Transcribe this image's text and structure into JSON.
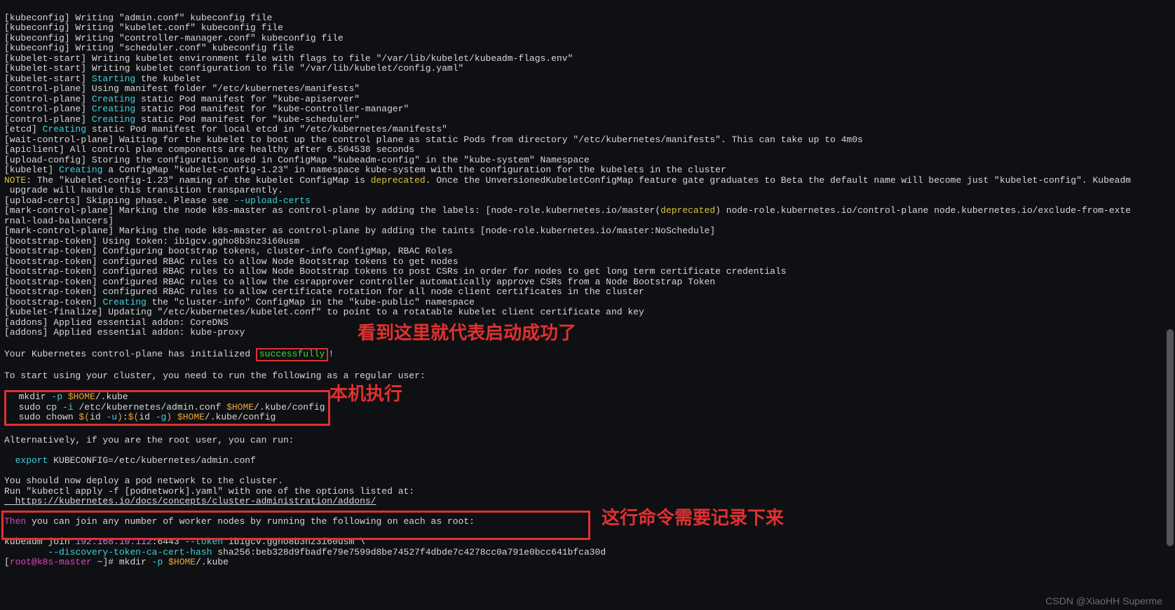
{
  "lines": {
    "l1": "[kubeconfig] Writing \"admin.conf\" kubeconfig file",
    "l2": "[kubeconfig] Writing \"kubelet.conf\" kubeconfig file",
    "l3": "[kubeconfig] Writing \"controller-manager.conf\" kubeconfig file",
    "l4": "[kubeconfig] Writing \"scheduler.conf\" kubeconfig file",
    "l5": "[kubelet-start] Writing kubelet environment file with flags to file \"/var/lib/kubelet/kubeadm-flags.env\"",
    "l6": "[kubelet-start] Writing kubelet configuration to file \"/var/lib/kubelet/config.yaml\"",
    "l7a": "[kubelet-start] ",
    "l7b": "Starting",
    "l7c": " the kubelet",
    "l8": "[control-plane] Using manifest folder \"/etc/kubernetes/manifests\"",
    "l9a": "[control-plane] ",
    "l9b": "Creating",
    "l9c": " static Pod manifest for \"kube-apiserver\"",
    "l10a": "[control-plane] ",
    "l10b": "Creating",
    "l10c": " static Pod manifest for \"kube-controller-manager\"",
    "l11a": "[control-plane] ",
    "l11b": "Creating",
    "l11c": " static Pod manifest for \"kube-scheduler\"",
    "l12a": "[etcd] ",
    "l12b": "Creating",
    "l12c": " static Pod manifest for local etcd in \"/etc/kubernetes/manifests\"",
    "l13": "[wait-control-plane] Waiting for the kubelet to boot up the control plane as static Pods from directory \"/etc/kubernetes/manifests\". This can take up to 4m0s",
    "l14": "[apiclient] All control plane components are healthy after 6.504538 seconds",
    "l15": "[upload-config] Storing the configuration used in ConfigMap \"kubeadm-config\" in the \"kube-system\" Namespace",
    "l16a": "[kubelet] ",
    "l16b": "Creating",
    "l16c": " a ConfigMap \"kubelet-config-1.23\" in namespace kube-system with the configuration for the kubelets in the cluster",
    "l17a": "NOTE",
    "l17b": ": The \"kubelet-config-1.23\" naming of the kubelet ConfigMap is ",
    "l17c": "deprecated",
    "l17d": ". Once the UnversionedKubeletConfigMap feature gate graduates to Beta the default name will become just \"kubelet-config\". Kubeadm",
    "l18": " upgrade will handle this transition transparently.",
    "l19a": "[upload-certs] Skipping phase. Please see ",
    "l19b": "--upload-certs",
    "l20a": "[mark-control-plane] Marking the node k8s-master as control-plane by adding the labels: [node-role.kubernetes.io/master(",
    "l20b": "deprecated",
    "l20c": ") node-role.kubernetes.io/control-plane node.kubernetes.io/exclude-from-exte",
    "l21": "rnal-load-balancers]",
    "l22": "[mark-control-plane] Marking the node k8s-master as control-plane by adding the taints [node-role.kubernetes.io/master:NoSchedule]",
    "l23": "[bootstrap-token] Using token: ib1gcv.ggho8b3nz3i60usm",
    "l24": "[bootstrap-token] Configuring bootstrap tokens, cluster-info ConfigMap, RBAC Roles",
    "l25": "[bootstrap-token] configured RBAC rules to allow Node Bootstrap tokens to get nodes",
    "l26": "[bootstrap-token] configured RBAC rules to allow Node Bootstrap tokens to post CSRs in order for nodes to get long term certificate credentials",
    "l27": "[bootstrap-token] configured RBAC rules to allow the csrapprover controller automatically approve CSRs from a Node Bootstrap Token",
    "l28": "[bootstrap-token] configured RBAC rules to allow certificate rotation for all node client certificates in the cluster",
    "l29a": "[bootstrap-token] ",
    "l29b": "Creating",
    "l29c": " the \"cluster-info\" ConfigMap in the \"kube-public\" namespace",
    "l30": "[kubelet-finalize] Updating \"/etc/kubernetes/kubelet.conf\" to point to a rotatable kubelet client certificate and key",
    "l31": "[addons] Applied essential addon: CoreDNS",
    "l32": "[addons] Applied essential addon: kube-proxy",
    "l33a": "Your Kubernetes control-plane has initialized ",
    "l33b": "successfully",
    "l33c": "!",
    "l34": "To start using your cluster, you need to run the following as a regular user:",
    "l35a": "  mkdir",
    "l35b": " -p ",
    "l35c": "$HOME",
    "l35d": "/.kube",
    "l36a": "  sudo cp",
    "l36b": " -i ",
    "l36c": "/etc/kubernetes/admin.conf ",
    "l36d": "$HOME",
    "l36e": "/.kube/config",
    "l37a": "  sudo chown ",
    "l37b": "$(",
    "l37c": "id",
    "l37d": " -u",
    "l37e": ")",
    "l37f": ":",
    "l37g": "$(",
    "l37h": "id",
    "l37i": " -g",
    "l37j": ")",
    "l37k": " $HOME",
    "l37l": "/.kube/config",
    "l38": "Alternatively, if you are the root user, you can run:",
    "l39a": "  export",
    "l39b": " KUBECONFIG=/etc/kubernetes/admin.conf",
    "l40": "You should now deploy a pod network to the cluster.",
    "l41": "Run \"kubectl apply -f [podnetwork].yaml\" with one of the options listed at:",
    "l42": "  https://kubernetes.io/docs/concepts/cluster-administration/addons/",
    "l43a": "Then",
    "l43b": " you can join any number of worker nodes by running the following on each as root:",
    "l44a": "kubeadm join ",
    "l44b": "192.168.10.112",
    "l44c": ":6443 ",
    "l44d": "--token",
    "l44e": " ib1gcv.ggho8b3nz3i60usm \\",
    "l45a": "        ",
    "l45b": "--discovery-token-ca-cert-hash",
    "l45c": " sha256:beb328d9fbadfe79e7599d8be74527f4dbde7c4278cc0a791e0bcc641bfca30d",
    "l46a": "[",
    "l46b": "root@k8s-master",
    "l46c": " ~",
    "l46d": "]# ",
    "l46e": "mkdir",
    "l46f": " -p ",
    "l46g": "$HOME",
    "l46h": "/.kube"
  },
  "annotations": {
    "a1": "看到这里就代表启动成功了",
    "a2": "本机执行",
    "a3": "这行命令需要记录下来"
  },
  "watermark": "CSDN @XiaoHH Superme"
}
